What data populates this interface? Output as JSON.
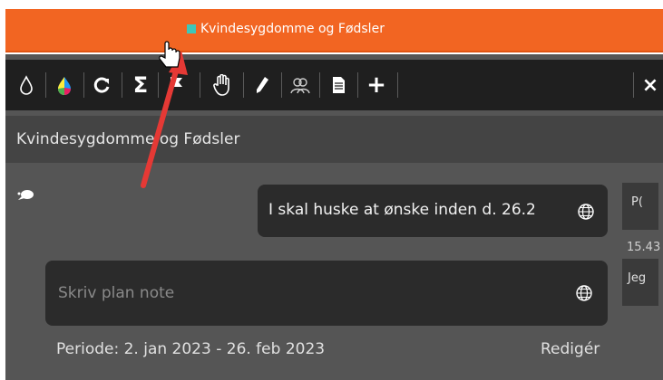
{
  "titlebar": {
    "title": "Kvindesygdomme og Fødsler",
    "accent": "#f26522",
    "dot_color": "#3ec7b8"
  },
  "toolbar": {
    "icons": [
      "drop-icon",
      "color-palette-icon",
      "refresh-icon",
      "sigma-icon",
      "flag-icon",
      "hand-icon",
      "pen-icon",
      "people-icon",
      "document-icon",
      "plus-icon"
    ],
    "close_label": "×"
  },
  "header": {
    "title": "Kvindesygdomme og Fødsler"
  },
  "message": {
    "text": "I skal huske at ønske inden d. 26.2",
    "avatar": "P(",
    "time": "15.43"
  },
  "note": {
    "placeholder": "Skriv plan note",
    "avatar": "Jeg"
  },
  "footer": {
    "period": "Periode: 2. jan 2023 - 26. feb 2023",
    "edit_label": "Redigér"
  },
  "annotation": {
    "arrow_color": "#e53935"
  }
}
